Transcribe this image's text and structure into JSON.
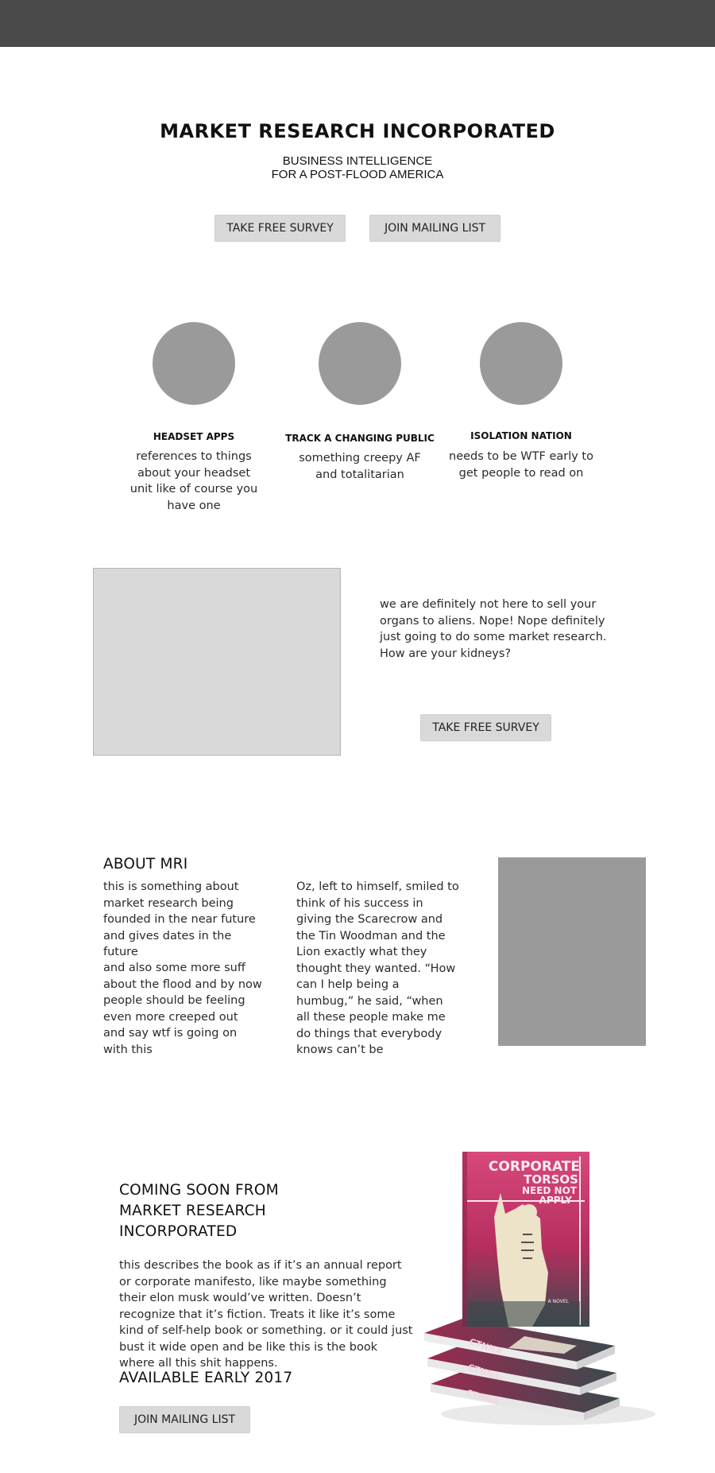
{
  "header": {
    "site_title": "MARKET RESEARCH INCORPORATED",
    "tagline_line1": "BUSINESS INTELLIGENCE",
    "tagline_line2": "FOR A POST-FLOOD AMERICA",
    "cta_survey": "TAKE FREE SURVEY",
    "cta_mailing": "JOIN MAILING LIST"
  },
  "features": [
    {
      "title": "HEADSET APPS",
      "text": "references to things about your headset unit like of course you have one"
    },
    {
      "title": "TRACK A CHANGING PUBLIC",
      "text": "something creepy AF and totalitarian"
    },
    {
      "title": "ISOLATION NATION",
      "text": "needs to be WTF early to get people to read on"
    }
  ],
  "organs": {
    "text": "we are definitely not here to sell your organs to aliens. Nope! Nope definitely just going to do some market research. How are your kidneys?",
    "button": "TAKE FREE SURVEY"
  },
  "about": {
    "heading": "ABOUT MRI",
    "col1_p1": "this is something about market research being founded in the near future and gives dates in the future",
    "col1_p2": "and also some more suff about the flood and by now people should be feeling even more creeped out and say wtf is going on with this",
    "col2": "Oz, left to himself, smiled to think of his success in giving the Scarecrow and the Tin Woodman and the Lion exactly what they thought they wanted.  “How can I help being a humbug,” he said, “when all these people make me do things that everybody knows can’t be"
  },
  "book": {
    "heading_line1": "COMING SOON FROM",
    "heading_line2": "MARKET RESEARCH",
    "heading_line3": "INCORPORATED",
    "description": "this describes the book as if it’s an annual report or corporate manifesto, like maybe something their elon musk would’ve written. Doesn’t recognize that it’s fiction. Treats it like it’s some kind of self-help book or something. or it could just bust it wide open and be like this is the book where all this shit happens.",
    "availability": "AVAILABLE EARLY 2017",
    "button": "JOIN MAILING LIST",
    "cover_title_line1": "CORPORATE",
    "cover_title_line2": "TORSOS",
    "cover_title_line3": "NEED NOT",
    "cover_title_line4": "APPLY",
    "cover_subtitle": "A NOVEL",
    "spine_text": "CTNNA"
  },
  "colors": {
    "topbar": "#4a4a4a",
    "button_bg": "#d9d9d9",
    "placeholder_light": "#d9d9d9",
    "placeholder_dark": "#9a9a9a",
    "cover_pink": "#c8336a",
    "cover_dark": "#3b4a4d"
  }
}
